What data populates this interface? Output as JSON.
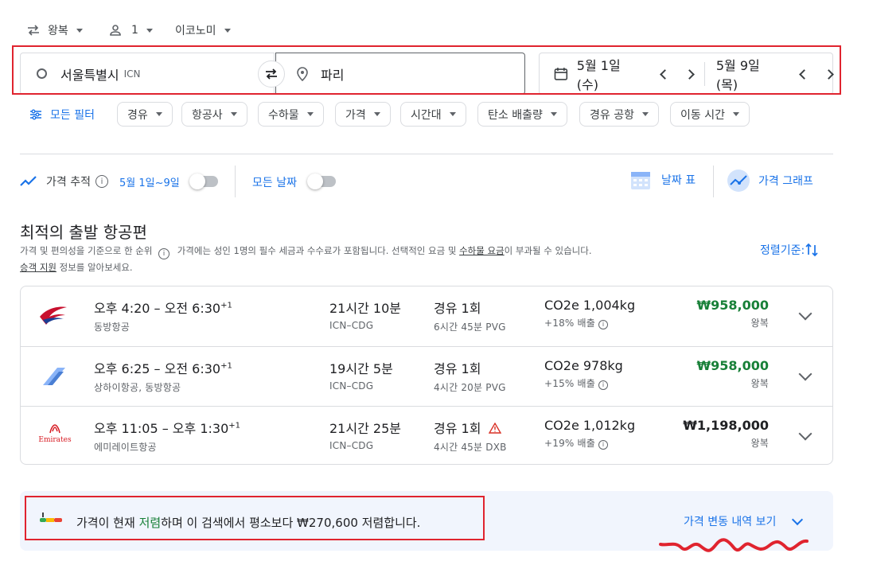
{
  "top_bar": {
    "trip_type": "왕복",
    "passengers": "1",
    "cabin_class": "이코노미"
  },
  "search": {
    "origin": "서울특별시",
    "origin_code": "ICN",
    "destination": "파리",
    "depart_date": "5월 1일 (수)",
    "return_date": "5월 9일 (목)"
  },
  "filters": {
    "all_filters": "모든 필터",
    "chips": [
      "경유",
      "항공사",
      "수하물",
      "가격",
      "시간대",
      "탄소 배출량",
      "경유 공항",
      "이동 시간"
    ]
  },
  "tracking": {
    "label": "가격 추적",
    "dates": "5월 1일~9일",
    "all_dates": "모든 날짜",
    "date_grid": "날짜 표",
    "price_graph": "가격 그래프"
  },
  "results": {
    "heading": "최적의 출발 항공편",
    "note_part1": "가격 및 편의성을 기준으로 한 순위",
    "note_part2": "가격에는 성인 1명의 필수 세금과 수수료가 포함됩니다. 선택적인 요금 및",
    "note_link": "수하물 요금",
    "note_part3": "이 부과될 수 있습니다.",
    "note_line2_link": "승객 지원",
    "note_line2_rest": "정보를 알아보세요.",
    "sort_label": "정렬기준:"
  },
  "flights": [
    {
      "times": "오후 4:20 – 오전 6:30",
      "day_offset": "+1",
      "airline": "동방항공",
      "duration": "21시간 10분",
      "route": "ICN–CDG",
      "stops": "경유 1회",
      "layover": "6시간 45분 PVG",
      "co2": "CO2e 1,004kg",
      "co2_diff": "+18% 배출",
      "price": "₩958,000",
      "price_type": "왕복",
      "price_color": "#188038",
      "warning": false
    },
    {
      "times": "오후 6:25 – 오전 6:30",
      "day_offset": "+1",
      "airline": "상하이항공, 동방항공",
      "duration": "19시간 5분",
      "route": "ICN–CDG",
      "stops": "경유 1회",
      "layover": "4시간 20분 PVG",
      "co2": "CO2e 978kg",
      "co2_diff": "+15% 배출",
      "price": "₩958,000",
      "price_type": "왕복",
      "price_color": "#188038",
      "warning": false
    },
    {
      "times": "오후 11:05 – 오후 1:30",
      "day_offset": "+1",
      "airline": "에미레이트항공",
      "duration": "21시간 25분",
      "route": "ICN–CDG",
      "stops": "경유 1회",
      "layover": "4시간 45분 DXB",
      "co2": "CO2e 1,012kg",
      "co2_diff": "+19% 배출",
      "price": "₩1,198,000",
      "price_type": "왕복",
      "price_color": "#202124",
      "warning": true,
      "logo_text": "Emirates"
    }
  ],
  "insight": {
    "text_before": "가격이 현재",
    "text_highlight": "저렴",
    "text_after": "하며 이 검색에서 평소보다 ₩270,600 저렴합니다.",
    "history_link": "가격 변동 내역 보기"
  },
  "colors": {
    "accent": "#1a73e8",
    "annotation_red": "#e0242f",
    "low_price_green": "#188038"
  }
}
